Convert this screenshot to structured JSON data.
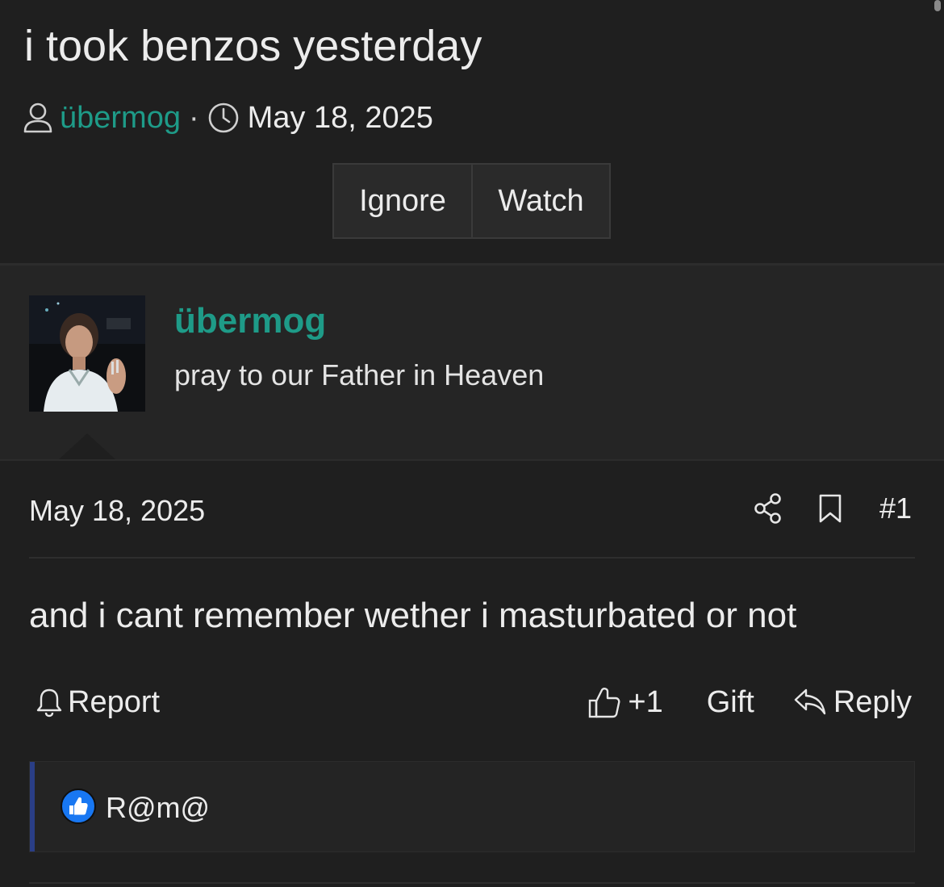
{
  "thread": {
    "title": "i took benzos yesterday",
    "author": "übermog",
    "separator": "·",
    "date": "May 18, 2025",
    "buttons": {
      "ignore": "Ignore",
      "watch": "Watch"
    }
  },
  "post": {
    "user": {
      "name": "übermog",
      "title": "pray to our Father in Heaven"
    },
    "date": "May 18, 2025",
    "number": "#1",
    "body": "and i cant remember wether i masturbated or not",
    "actions": {
      "report": "Report",
      "like_count": "+1",
      "gift": "Gift",
      "reply": "Reply"
    },
    "reactions": {
      "icon": "thumbs-up-icon",
      "users": "R@m@"
    }
  },
  "colors": {
    "background": "#1f1f1f",
    "user_panel": "#252525",
    "accent": "#1e9b88",
    "reaction_bar": "#2a3e86",
    "like_badge": "#1877f2"
  }
}
